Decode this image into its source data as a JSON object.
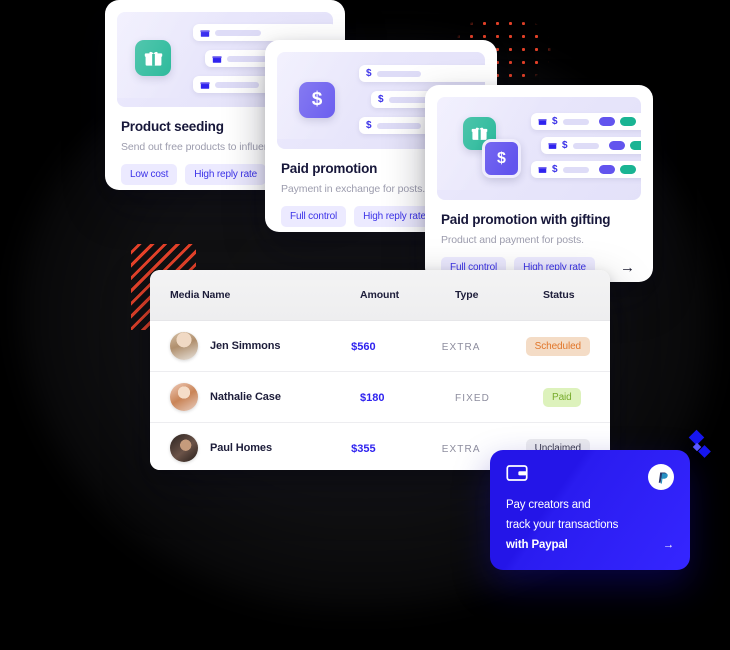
{
  "cards": [
    {
      "id": "product-seeding",
      "title": "Product seeding",
      "subtitle": "Send out free products to influencers.",
      "tags": [
        "Low cost",
        "High reply rate"
      ],
      "icons": [
        "gift-icon"
      ]
    },
    {
      "id": "paid-promotion",
      "title": "Paid promotion",
      "subtitle": "Payment in exchange for posts.",
      "tags": [
        "Full control",
        "High reply rate"
      ],
      "icons": [
        "dollar-icon"
      ]
    },
    {
      "id": "paid-promotion-with-gifting",
      "title": "Paid promotion with gifting",
      "subtitle": "Product and payment for posts.",
      "tags": [
        "Full control",
        "High reply rate"
      ],
      "icons": [
        "gift-icon",
        "dollar-icon"
      ],
      "arrow": "→"
    }
  ],
  "table": {
    "columns": [
      "Media Name",
      "Amount",
      "Type",
      "Status"
    ],
    "rows": [
      {
        "name": "Jen Simmons",
        "amount": "$560",
        "type": "EXTRA",
        "status": "Scheduled",
        "status_style": "scheduled"
      },
      {
        "name": "Nathalie Case",
        "amount": "$180",
        "type": "FIXED",
        "status": "Paid",
        "status_style": "paid"
      },
      {
        "name": "Paul Homes",
        "amount": "$355",
        "type": "EXTRA",
        "status": "Unclaimed",
        "status_style": "unclaimed"
      }
    ]
  },
  "paypal": {
    "line1": "Pay creators and",
    "line2": "track your transactions",
    "line3": "with Paypal",
    "arrow": "→",
    "wallet_icon": "wallet-icon",
    "brand_icon": "paypal-logo-icon"
  },
  "colors": {
    "accent_violet": "#6254ee",
    "accent_green": "#1ab493",
    "tag_text": "#3b32e8",
    "tag_bg": "#eceaff",
    "amount_blue": "#2f23ef",
    "paypal_blue": "#2415e8",
    "deco_red": "#f0452b",
    "deco_diamond_blue": "#1717f0"
  }
}
